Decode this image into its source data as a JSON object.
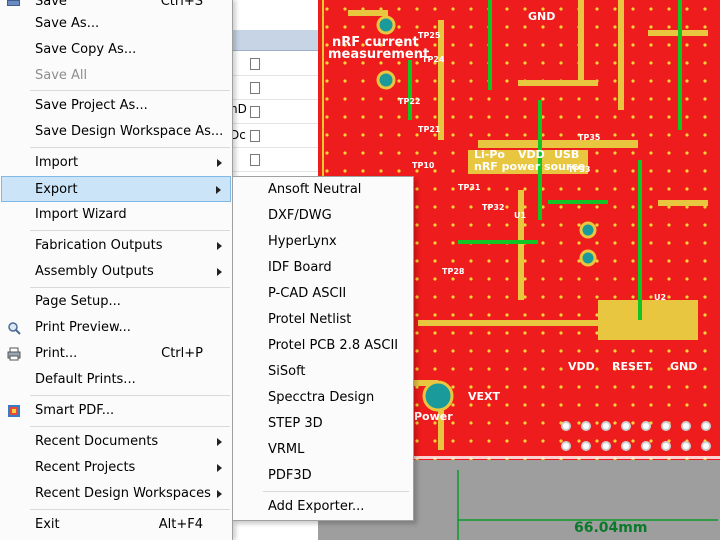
{
  "file_menu": {
    "items": [
      {
        "label": "Save",
        "shortcut": "Ctrl+S",
        "submenu": false,
        "disabled": false
      },
      {
        "label": "Save As...",
        "shortcut": "",
        "submenu": false,
        "disabled": false
      },
      {
        "label": "Save Copy As...",
        "shortcut": "",
        "submenu": false,
        "disabled": false
      },
      {
        "label": "Save All",
        "shortcut": "",
        "submenu": false,
        "disabled": true
      },
      {
        "label": "Save Project As...",
        "shortcut": "",
        "submenu": false,
        "disabled": false
      },
      {
        "label": "Save Design Workspace As...",
        "shortcut": "",
        "submenu": false,
        "disabled": false
      },
      {
        "label": "Import",
        "shortcut": "",
        "submenu": true,
        "disabled": false
      },
      {
        "label": "Export",
        "shortcut": "",
        "submenu": true,
        "disabled": false,
        "highlighted": true
      },
      {
        "label": "Import Wizard",
        "shortcut": "",
        "submenu": false,
        "disabled": false
      },
      {
        "label": "Fabrication Outputs",
        "shortcut": "",
        "submenu": true,
        "disabled": false
      },
      {
        "label": "Assembly Outputs",
        "shortcut": "",
        "submenu": true,
        "disabled": false
      },
      {
        "label": "Page Setup...",
        "shortcut": "",
        "submenu": false,
        "disabled": false
      },
      {
        "label": "Print Preview...",
        "shortcut": "",
        "submenu": false,
        "disabled": false,
        "icon": "print-preview-icon"
      },
      {
        "label": "Print...",
        "shortcut": "Ctrl+P",
        "submenu": false,
        "disabled": false,
        "icon": "printer-icon"
      },
      {
        "label": "Default Prints...",
        "shortcut": "",
        "submenu": false,
        "disabled": false
      },
      {
        "label": "Smart PDF...",
        "shortcut": "",
        "submenu": false,
        "disabled": false,
        "icon": "smart-pdf-icon"
      },
      {
        "label": "Recent Documents",
        "shortcut": "",
        "submenu": true,
        "disabled": false
      },
      {
        "label": "Recent Projects",
        "shortcut": "",
        "submenu": true,
        "disabled": false
      },
      {
        "label": "Recent Design Workspaces",
        "shortcut": "",
        "submenu": true,
        "disabled": false
      },
      {
        "label": "Exit",
        "shortcut": "Alt+F4",
        "submenu": false,
        "disabled": false
      }
    ]
  },
  "export_submenu": {
    "items": [
      "Ansoft Neutral",
      "DXF/DWG",
      "HyperLynx",
      "IDF Board",
      "P-CAD ASCII",
      "Protel Netlist",
      "Protel PCB 2.8 ASCII",
      "SiSoft",
      "Specctra Design",
      "STEP 3D",
      "VRML",
      "PDF3D",
      "Add Exporter..."
    ]
  },
  "projects_panel": {
    "row_fragments": [
      "nD",
      "Dc"
    ]
  },
  "pcb": {
    "labels": [
      "nRF current",
      "measurement",
      "Li-Po",
      "VDD",
      "USB",
      "nRF power source",
      "TP25",
      "TP24",
      "TP22",
      "TP21",
      "TP10",
      "TP32",
      "TP31",
      "TP33",
      "TP28",
      "TP35",
      "U1",
      "U2",
      "GND",
      "RESET",
      "VDD",
      "Power",
      "VEXT",
      "GND"
    ],
    "dimension": "66.04mm"
  },
  "colors": {
    "menu_bg": "#fbfbfb",
    "highlight": "#cce4f7",
    "highlight_border": "#7fb9e8",
    "pcb_red": "#ee1c1c",
    "pcb_yellow": "#f0d020",
    "pcb_green": "#10c020"
  }
}
